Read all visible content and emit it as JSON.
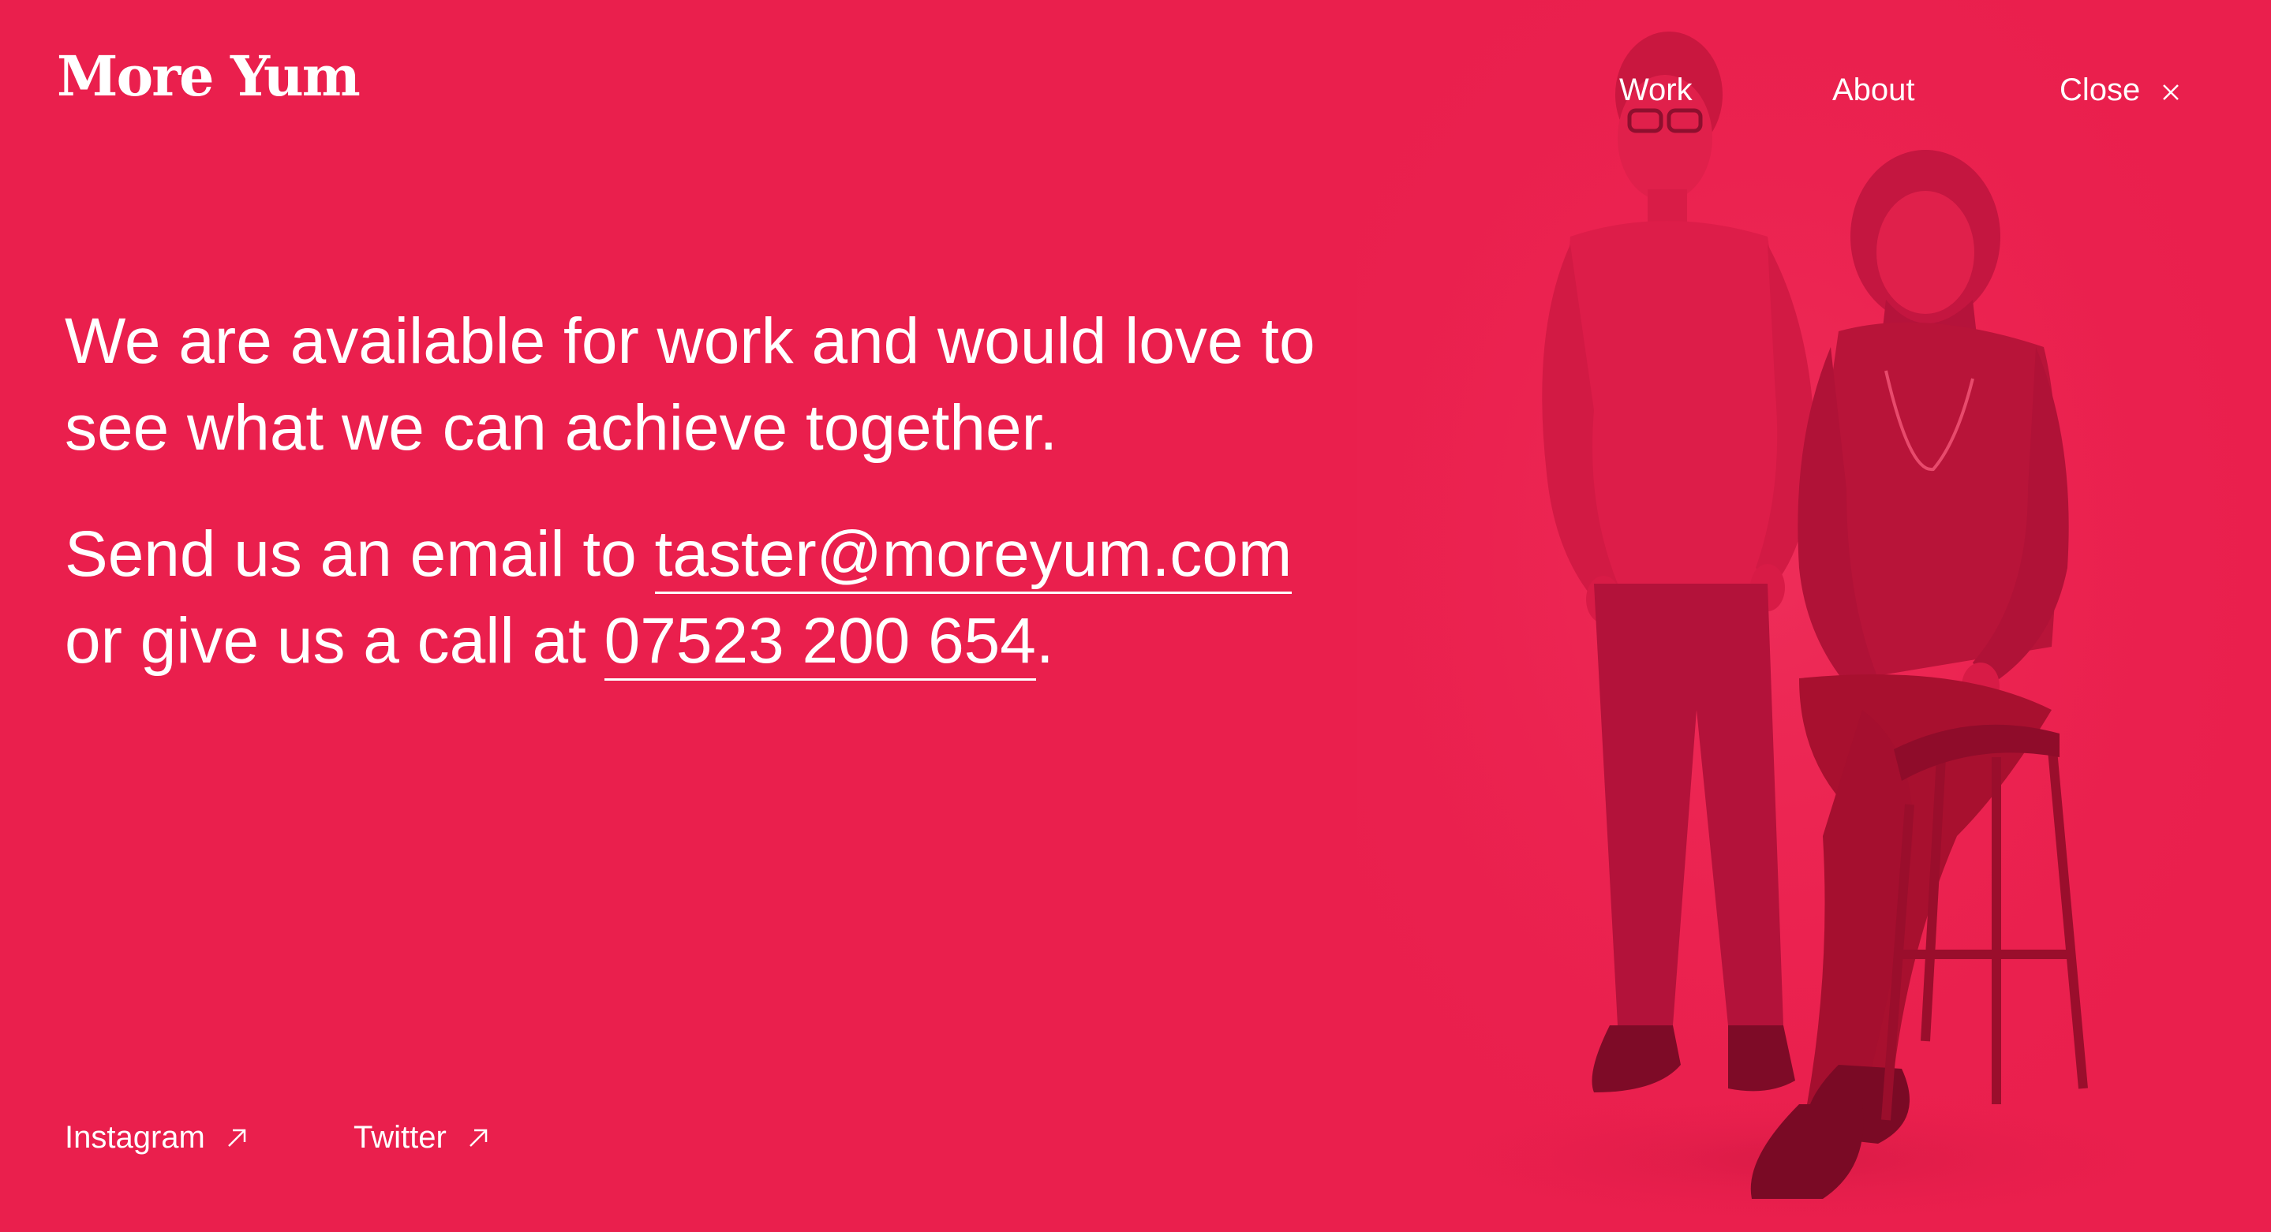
{
  "brand": {
    "logo_text": "More Yum"
  },
  "nav": {
    "work_label": "Work",
    "about_label": "About",
    "close_label": "Close"
  },
  "intro": {
    "text": "We are available for work and would love to see what we can achieve together."
  },
  "contact": {
    "email_prefix": "Send us an email to ",
    "email": "taster@moreyum.com",
    "phone_prefix": "or give us a call at ",
    "phone": "07523 200 654",
    "phone_suffix": "."
  },
  "social": {
    "instagram_label": "Instagram",
    "twitter_label": "Twitter"
  },
  "colors": {
    "background": "#ea1f4d",
    "text": "#ffffff",
    "photo_shadow": "#b3123a"
  },
  "icons": {
    "close": "close-icon",
    "external": "arrow-up-right-icon"
  }
}
